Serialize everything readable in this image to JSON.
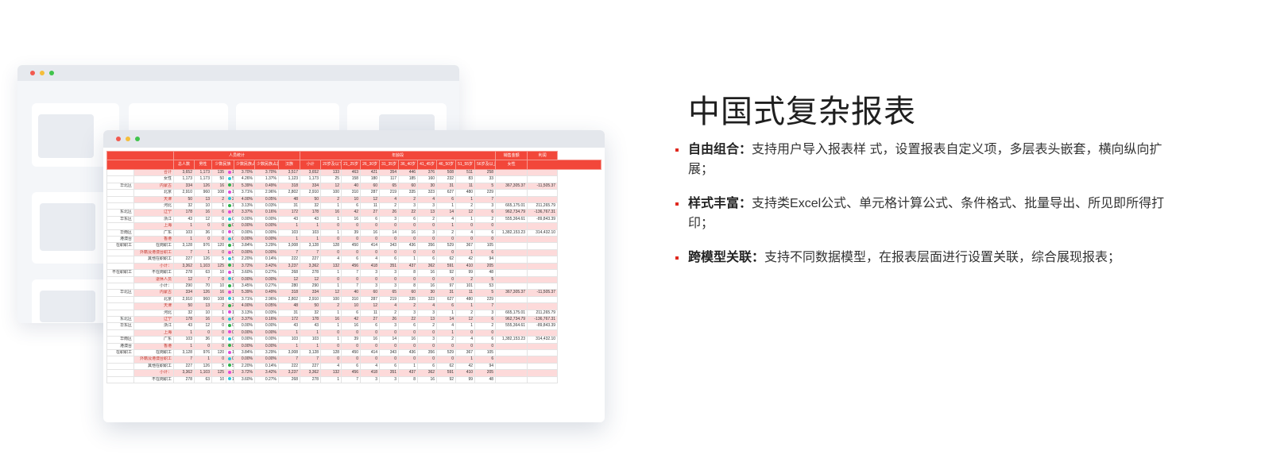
{
  "section": {
    "title": "中国式复杂报表",
    "features": [
      {
        "label": "自由组合：",
        "text": "支持用户导入报表样 式，设置报表自定义项，多层表头嵌套，横向纵向扩展；"
      },
      {
        "label": "样式丰富：",
        "text": "支持类Excel公式、单元格计算公式、条件格式、批量导出、所见即所得打印；"
      },
      {
        "label": "跨模型关联：",
        "text": "支持不同数据模型，在报表层面进行设置关联，综合展现报表；"
      }
    ]
  },
  "colors": {
    "accent": "#e0291f",
    "header_red": "#f2473a",
    "row_pink": "#fddada"
  },
  "report": {
    "group_headers": {
      "people": "人员统计",
      "age": "年龄段"
    },
    "columns": [
      "总人数",
      "男性",
      "女性",
      "少数民族",
      "少数民族占总人数比",
      "少数民族占总人数比",
      "汉族",
      "小计",
      "20岁及以下",
      "21_25岁",
      "26_30岁",
      "31_35岁",
      "36_40岁",
      "41_45岁",
      "46_50岁",
      "51_55岁",
      "56岁及以上",
      "销售金额",
      "利润"
    ],
    "rows": [
      {
        "region": "",
        "name": "合计",
        "v": [
          "3,652",
          "1,173",
          "135",
          "135",
          "3.70%",
          "3.70%",
          "3,517",
          "3,652",
          "133",
          "463",
          "421",
          "354",
          "446",
          "376",
          "508",
          "511",
          "258",
          "",
          ""
        ],
        "pink": true
      },
      {
        "region": "",
        "name": "女性",
        "v": [
          "1,173",
          "1,173",
          "50",
          "50",
          "4.26%",
          "1.37%",
          "1,123",
          "1,173",
          "25",
          "158",
          "180",
          "117",
          "185",
          "160",
          "232",
          "83",
          "33",
          "",
          ""
        ],
        "pink": false
      },
      {
        "region": "华北区",
        "name": "内蒙古",
        "v": [
          "334",
          "126",
          "16",
          "16",
          "5.39%",
          "0.49%",
          "318",
          "334",
          "12",
          "40",
          "60",
          "65",
          "60",
          "30",
          "31",
          "11",
          "5",
          "367,305.37",
          "-11,505.37"
        ],
        "pink": true
      },
      {
        "region": "",
        "name": "北京",
        "v": [
          "2,910",
          "960",
          "108",
          "108",
          "3.71%",
          "2.96%",
          "2,802",
          "2,910",
          "100",
          "310",
          "287",
          "219",
          "335",
          "323",
          "627",
          "480",
          "229",
          "",
          ""
        ],
        "pink": false
      },
      {
        "region": "",
        "name": "天津",
        "v": [
          "50",
          "13",
          "2",
          "2",
          "4.00%",
          "0.05%",
          "48",
          "50",
          "2",
          "10",
          "12",
          "4",
          "2",
          "4",
          "6",
          "1",
          "7",
          "",
          ""
        ],
        "pink": true
      },
      {
        "region": "",
        "name": "河北",
        "v": [
          "32",
          "10",
          "1",
          "1",
          "3.13%",
          "0.03%",
          "31",
          "32",
          "1",
          "6",
          "11",
          "2",
          "3",
          "3",
          "1",
          "2",
          "3",
          "665,175.01",
          "211,265.79"
        ],
        "pink": false
      },
      {
        "region": "东北区",
        "name": "辽宁",
        "v": [
          "178",
          "16",
          "6",
          "6",
          "3.37%",
          "0.16%",
          "172",
          "178",
          "16",
          "42",
          "27",
          "26",
          "22",
          "13",
          "14",
          "12",
          "6",
          "962,734.79",
          "-136,767.31"
        ],
        "pink": true
      },
      {
        "region": "华东区",
        "name": "浙江",
        "v": [
          "43",
          "12",
          "0",
          "0",
          "0.00%",
          "0.00%",
          "43",
          "43",
          "1",
          "16",
          "6",
          "3",
          "6",
          "2",
          "4",
          "1",
          "2",
          "555,364.61",
          "-89,843.39"
        ],
        "pink": false
      },
      {
        "region": "",
        "name": "上海",
        "v": [
          "1",
          "0",
          "0",
          "0",
          "0.00%",
          "0.00%",
          "1",
          "1",
          "0",
          "0",
          "0",
          "0",
          "0",
          "0",
          "1",
          "0",
          "0",
          "",
          ""
        ],
        "pink": true
      },
      {
        "region": "华南区",
        "name": "广东",
        "v": [
          "103",
          "36",
          "0",
          "0",
          "0.00%",
          "0.00%",
          "103",
          "103",
          "1",
          "39",
          "16",
          "14",
          "16",
          "3",
          "2",
          "4",
          "6",
          "1,382,153.23",
          "314,432.10"
        ],
        "pink": false
      },
      {
        "region": "港澳台",
        "name": "香港",
        "v": [
          "1",
          "0",
          "0",
          "0",
          "0.00%",
          "0.00%",
          "1",
          "1",
          "0",
          "0",
          "0",
          "0",
          "0",
          "0",
          "0",
          "0",
          "0",
          "",
          ""
        ],
        "pink": true
      },
      {
        "region": "在职职工",
        "name": "在岗职工",
        "v": [
          "3,128",
          "976",
          "120",
          "120",
          "3.84%",
          "3.29%",
          "3,008",
          "3,128",
          "128",
          "450",
          "414",
          "343",
          "436",
          "356",
          "529",
          "367",
          "105",
          "",
          ""
        ],
        "pink": false
      },
      {
        "region": "",
        "name": "外籍及港澳台职工",
        "v": [
          "7",
          "1",
          "0",
          "0",
          "0.00%",
          "0.00%",
          "7",
          "7",
          "0",
          "0",
          "0",
          "0",
          "0",
          "0",
          "0",
          "1",
          "6",
          "",
          ""
        ],
        "pink": true
      },
      {
        "region": "",
        "name": "其他在职职工",
        "v": [
          "227",
          "126",
          "5",
          "5",
          "2.20%",
          "0.14%",
          "222",
          "227",
          "4",
          "6",
          "4",
          "6",
          "1",
          "6",
          "62",
          "42",
          "94",
          "",
          ""
        ],
        "pink": false
      },
      {
        "region": "",
        "name": "小计：",
        "v": [
          "3,362",
          "1,103",
          "125",
          "125",
          "3.72%",
          "3.42%",
          "3,237",
          "3,362",
          "132",
          "456",
          "418",
          "351",
          "437",
          "362",
          "591",
          "410",
          "205",
          "",
          ""
        ],
        "pink": true
      },
      {
        "region": "不在职职工",
        "name": "不在岗职工",
        "v": [
          "278",
          "63",
          "10",
          "10",
          "3.60%",
          "0.27%",
          "268",
          "278",
          "1",
          "7",
          "3",
          "3",
          "8",
          "16",
          "92",
          "99",
          "48",
          "",
          ""
        ],
        "pink": false
      },
      {
        "region": "",
        "name": "退休人员",
        "v": [
          "12",
          "7",
          "0",
          "0",
          "0.00%",
          "0.00%",
          "12",
          "12",
          "0",
          "0",
          "0",
          "0",
          "0",
          "0",
          "0",
          "2",
          "5",
          "",
          ""
        ],
        "pink": true
      },
      {
        "region": "",
        "name": "小计：",
        "v": [
          "290",
          "70",
          "10",
          "10",
          "3.45%",
          "0.27%",
          "280",
          "290",
          "1",
          "7",
          "3",
          "3",
          "8",
          "16",
          "97",
          "101",
          "53",
          "",
          ""
        ],
        "pink": false
      },
      {
        "region": "华北区",
        "name": "内蒙古",
        "v": [
          "334",
          "126",
          "16",
          "16",
          "5.39%",
          "0.49%",
          "318",
          "334",
          "12",
          "40",
          "60",
          "65",
          "60",
          "30",
          "31",
          "11",
          "5",
          "367,305.37",
          "-11,505.37"
        ],
        "pink": true
      },
      {
        "region": "",
        "name": "北京",
        "v": [
          "2,910",
          "960",
          "108",
          "108",
          "3.71%",
          "2.96%",
          "2,802",
          "2,910",
          "100",
          "310",
          "287",
          "219",
          "335",
          "323",
          "627",
          "480",
          "229",
          "",
          ""
        ],
        "pink": false
      },
      {
        "region": "",
        "name": "天津",
        "v": [
          "50",
          "13",
          "2",
          "2",
          "4.00%",
          "0.05%",
          "48",
          "50",
          "2",
          "10",
          "12",
          "4",
          "2",
          "4",
          "6",
          "1",
          "7",
          "",
          ""
        ],
        "pink": true
      },
      {
        "region": "",
        "name": "河北",
        "v": [
          "32",
          "10",
          "1",
          "1",
          "3.13%",
          "0.03%",
          "31",
          "32",
          "1",
          "6",
          "11",
          "2",
          "3",
          "3",
          "1",
          "2",
          "3",
          "665,175.01",
          "211,265.79"
        ],
        "pink": false
      },
      {
        "region": "东北区",
        "name": "辽宁",
        "v": [
          "178",
          "16",
          "6",
          "6",
          "3.37%",
          "0.16%",
          "172",
          "178",
          "16",
          "42",
          "27",
          "26",
          "22",
          "13",
          "14",
          "12",
          "6",
          "962,734.79",
          "-136,767.31"
        ],
        "pink": true
      },
      {
        "region": "华东区",
        "name": "浙江",
        "v": [
          "43",
          "12",
          "0",
          "0",
          "0.00%",
          "0.00%",
          "43",
          "43",
          "1",
          "16",
          "6",
          "3",
          "6",
          "2",
          "4",
          "1",
          "2",
          "555,364.61",
          "-89,843.39"
        ],
        "pink": false
      },
      {
        "region": "",
        "name": "上海",
        "v": [
          "1",
          "0",
          "0",
          "0",
          "0.00%",
          "0.00%",
          "1",
          "1",
          "0",
          "0",
          "0",
          "0",
          "0",
          "0",
          "1",
          "0",
          "0",
          "",
          ""
        ],
        "pink": true
      },
      {
        "region": "华南区",
        "name": "广东",
        "v": [
          "103",
          "36",
          "0",
          "0",
          "0.00%",
          "0.00%",
          "103",
          "103",
          "1",
          "39",
          "16",
          "14",
          "16",
          "3",
          "2",
          "4",
          "6",
          "1,382,153.23",
          "314,432.10"
        ],
        "pink": false
      },
      {
        "region": "港澳台",
        "name": "香港",
        "v": [
          "1",
          "0",
          "0",
          "0",
          "0.00%",
          "0.00%",
          "1",
          "1",
          "0",
          "0",
          "0",
          "0",
          "0",
          "0",
          "0",
          "0",
          "0",
          "",
          ""
        ],
        "pink": true
      },
      {
        "region": "在职职工",
        "name": "在岗职工",
        "v": [
          "3,128",
          "976",
          "120",
          "120",
          "3.84%",
          "3.29%",
          "3,008",
          "3,128",
          "128",
          "450",
          "414",
          "343",
          "436",
          "356",
          "529",
          "367",
          "105",
          "",
          ""
        ],
        "pink": false
      },
      {
        "region": "",
        "name": "外籍及港澳台职工",
        "v": [
          "7",
          "1",
          "0",
          "0",
          "0.00%",
          "0.00%",
          "7",
          "7",
          "0",
          "0",
          "0",
          "0",
          "0",
          "0",
          "0",
          "1",
          "6",
          "",
          ""
        ],
        "pink": true
      },
      {
        "region": "",
        "name": "其他在职职工",
        "v": [
          "227",
          "126",
          "5",
          "5",
          "2.20%",
          "0.14%",
          "222",
          "227",
          "4",
          "6",
          "4",
          "6",
          "1",
          "6",
          "62",
          "42",
          "94",
          "",
          ""
        ],
        "pink": false
      },
      {
        "region": "",
        "name": "小计：",
        "v": [
          "3,362",
          "1,103",
          "125",
          "125",
          "3.72%",
          "3.42%",
          "3,237",
          "3,362",
          "132",
          "456",
          "418",
          "351",
          "437",
          "362",
          "591",
          "410",
          "205",
          "",
          ""
        ],
        "pink": true
      },
      {
        "region": "",
        "name": "不在岗职工",
        "v": [
          "278",
          "63",
          "10",
          "10",
          "3.60%",
          "0.27%",
          "268",
          "278",
          "1",
          "7",
          "3",
          "3",
          "8",
          "16",
          "92",
          "99",
          "48",
          "",
          ""
        ],
        "pink": false
      }
    ]
  }
}
